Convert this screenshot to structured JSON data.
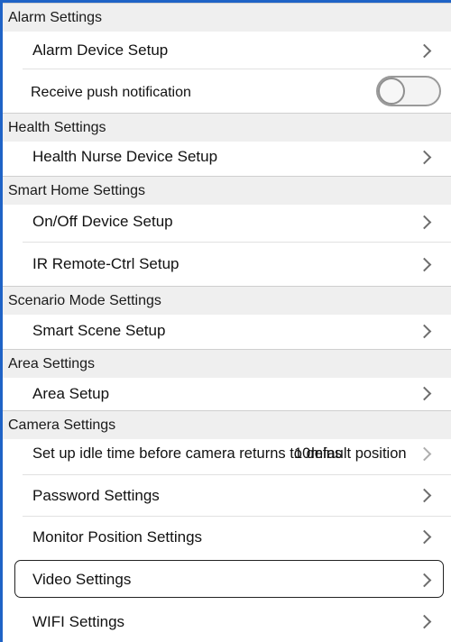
{
  "sections": {
    "alarm": "Alarm Settings",
    "health": "Health Settings",
    "smart_home": "Smart Home Settings",
    "scenario": "Scenario Mode Settings",
    "area": "Area Settings",
    "camera": "Camera Settings"
  },
  "rows": {
    "alarm_device_setup": "Alarm Device Setup",
    "receive_push": "Receive push notification",
    "health_nurse_setup": "Health Nurse Device Setup",
    "onoff_setup": "On/Off Device Setup",
    "ir_remote_setup": "IR Remote-Ctrl Setup",
    "smart_scene_setup": "Smart Scene Setup",
    "area_setup": "Area Setup",
    "camera_idle_time": "Set up idle time before camera returns to default position",
    "camera_idle_value": "10mins",
    "password_settings": "Password Settings",
    "monitor_position": "Monitor Position Settings",
    "video_settings": "Video Settings",
    "wifi_settings": "WIFI Settings"
  },
  "toggles": {
    "receive_push_enabled": false
  },
  "colors": {
    "accent_border": "#1f63c6",
    "section_bg": "#efefef",
    "chevron": "#6d6d6d"
  },
  "icons": {
    "row_arrow": "chevron-right-icon",
    "toggle": "toggle-switch-icon"
  }
}
